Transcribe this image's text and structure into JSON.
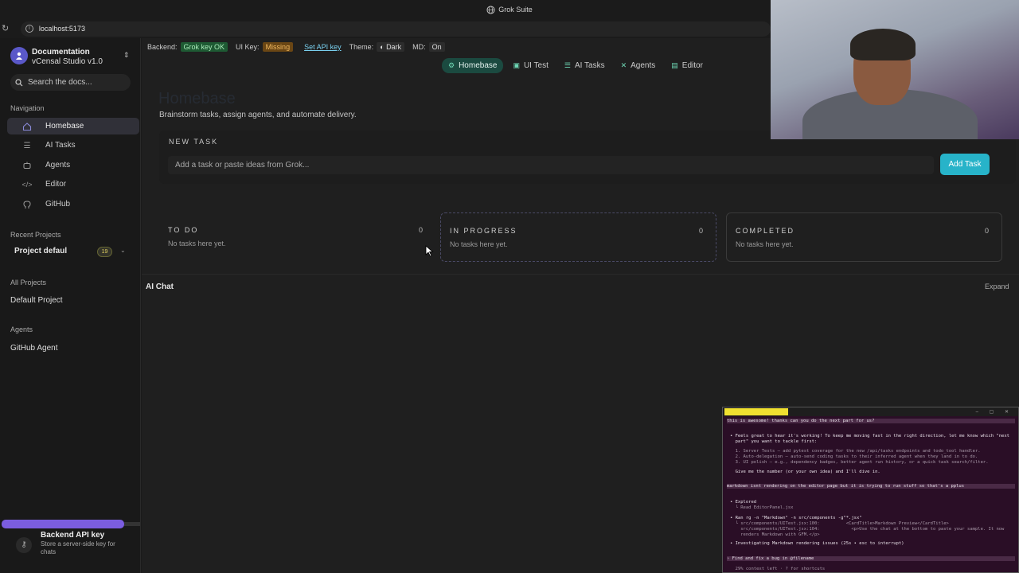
{
  "window": {
    "title": "Grok Suite",
    "url": "localhost:5173"
  },
  "sidebar": {
    "org_name": "Documentation",
    "org_version": "vCensal Studio v1.0",
    "search_placeholder": "Search the docs...",
    "nav_heading": "Navigation",
    "nav": [
      {
        "label": "Homebase",
        "icon": "home-icon",
        "active": true
      },
      {
        "label": "AI Tasks",
        "icon": "list-icon"
      },
      {
        "label": "Agents",
        "icon": "bot-icon"
      },
      {
        "label": "Editor",
        "icon": "code-icon"
      },
      {
        "label": "GitHub",
        "icon": "github-icon"
      }
    ],
    "recent_heading": "Recent Projects",
    "recent_project": "Project defaul",
    "recent_count": "19",
    "all_heading": "All Projects",
    "all_project": "Default Project",
    "agents_heading": "Agents",
    "agent": "GitHub Agent",
    "key_card": {
      "title": "Backend API key",
      "desc": "Store a server-side key for chats"
    }
  },
  "status": {
    "backend_label": "Backend:",
    "backend_value": "Grok key OK",
    "uikey_label": "UI Key:",
    "uikey_value": "Missing",
    "set_key": "Set API key",
    "theme_label": "Theme:",
    "theme_value": "Dark",
    "md_label": "MD:",
    "md_value": "On"
  },
  "tabs": [
    {
      "label": "Homebase",
      "active": true
    },
    {
      "label": "UI Test"
    },
    {
      "label": "AI Tasks"
    },
    {
      "label": "Agents"
    },
    {
      "label": "Editor"
    }
  ],
  "page": {
    "title": "Homebase",
    "subtitle": "Brainstorm tasks, assign agents, and automate delivery.",
    "new_task_label": "NEW TASK",
    "new_task_placeholder": "Add a task or paste ideas from Grok...",
    "add_button": "Add Task"
  },
  "columns": [
    {
      "title": "TO DO",
      "count": "0",
      "empty": "No tasks here yet."
    },
    {
      "title": "IN PROGRESS",
      "count": "0",
      "empty": "No tasks here yet."
    },
    {
      "title": "COMPLETED",
      "count": "0",
      "empty": "No tasks here yet."
    }
  ],
  "chat": {
    "title": "AI Chat",
    "expand": "Expand"
  },
  "terminal": {
    "lines": [
      "this is awesome! thanks can you do the next part for us?",
      "• Feels great to hear it's working! To keep me moving fast in the right direction, let me know which \"next",
      "  part\" you want to tackle first:",
      "  1. Server Tests – add pytest coverage for the new /api/tasks endpoints and todo_tool handler.",
      "  2. Auto-delegation – auto-send coding tasks to their inferred agent when they land in to do.",
      "  3. UI polish – e.g., dependency badges, better agent run history, or a quick task search/filter.",
      "  Give me the number (or your own idea) and I'll dive in.",
      "markdown isnt rendering on the editor page but it is trying to run stuff so that's a pplus",
      "• Explored",
      "  └ Read EditorPanel.jsx",
      "• Ran rg -n \"Markdown\" -n src/components -g\"*.jsx\"",
      "  └ src/components/UITest.jsx:100:          <CardTitle>Markdown Preview</CardTitle>",
      "    src/components/UITest.jsx:104:            <p>Use the chat at the bottom to paste your sample. It now",
      "    renders Markdown with GFM.</p>",
      "• Investigating Markdown rendering issues (25s • esc to interrupt)",
      "› Find and fix a bug in @filename",
      "  29% context left · ? for shortcuts"
    ]
  }
}
